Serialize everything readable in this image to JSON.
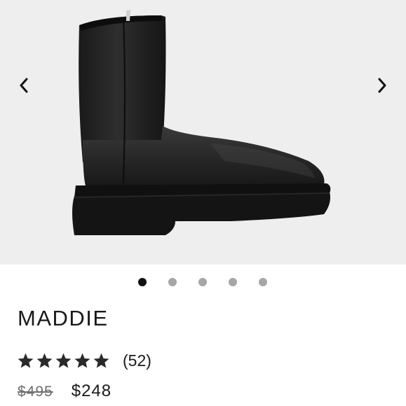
{
  "product": {
    "name": "MADDIE",
    "rating_value": 5,
    "rating_max": 5,
    "review_count": "(52)",
    "original_price": "$495",
    "sale_price": "$248"
  },
  "gallery": {
    "image_count": 5,
    "active_index": 0,
    "background": "#eeeeee",
    "prev_icon": "chevron-left-icon",
    "next_icon": "chevron-right-icon"
  },
  "colors": {
    "star": "#2a2a2a",
    "dot_active": "#111111",
    "dot_inactive": "#a6a6a6"
  }
}
